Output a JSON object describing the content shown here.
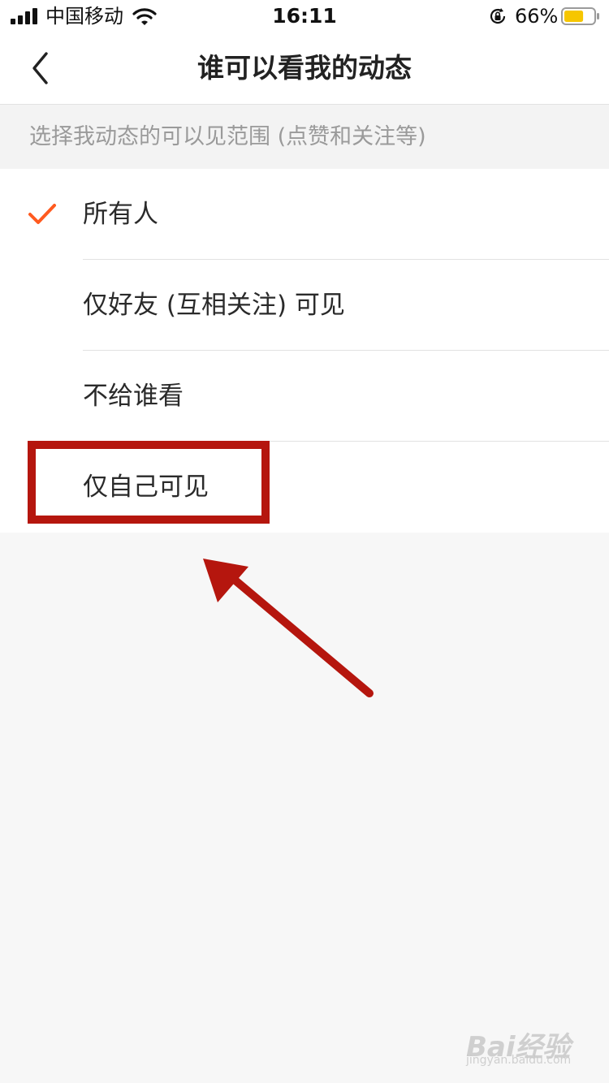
{
  "status_bar": {
    "carrier": "中国移动",
    "time": "16:11",
    "battery_percent": "66%",
    "battery_level": 0.66
  },
  "nav": {
    "title": "谁可以看我的动态"
  },
  "section": {
    "header": "选择我动态的可以见范围 (点赞和关注等)"
  },
  "options": [
    {
      "label": "所有人",
      "selected": true
    },
    {
      "label": "仅好友 (互相关注) 可见",
      "selected": false
    },
    {
      "label": "不给谁看",
      "selected": false
    },
    {
      "label": "仅自己可见",
      "selected": false
    }
  ],
  "watermark": {
    "text": "Bai经验",
    "sub": "jingyan.baidu.com"
  },
  "colors": {
    "accent": "#ff5a1f",
    "annotation": "#b5160e"
  }
}
